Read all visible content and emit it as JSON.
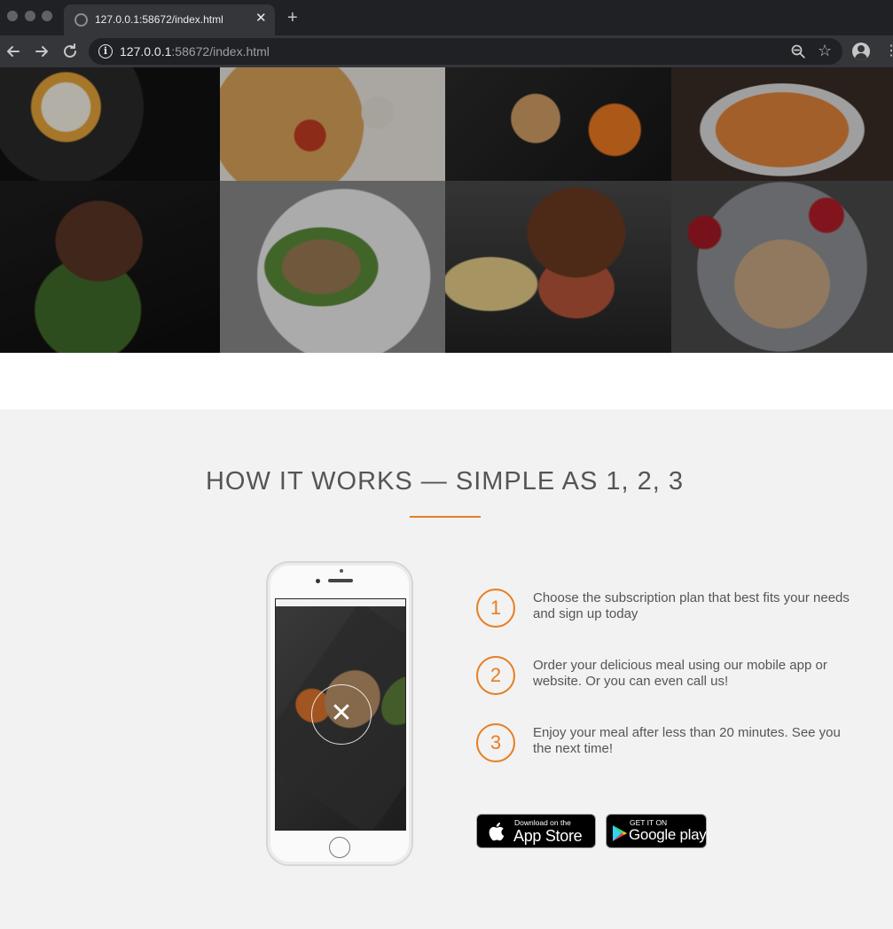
{
  "browser": {
    "tab_title": "127.0.0.1:58672/index.html",
    "tab_close": "✕",
    "new_tab": "+",
    "url_host": "127.0.0.1",
    "url_rest": ":58672/index.html",
    "colors": {
      "frame": "#202124",
      "toolbar": "#35363a"
    }
  },
  "gallery": {
    "tiles": [
      "egg-bibimbap",
      "pizza",
      "chicken-carrots",
      "pumpkin-soup",
      "steak-beans",
      "sandwich",
      "burger-fries",
      "granola-cherries"
    ]
  },
  "how_it_works": {
    "title": "HOW IT WORKS — SIMPLE AS 1, 2, 3",
    "accent_color": "#e67e22",
    "steps": [
      {
        "number": "1",
        "text": "Choose the subscription plan that best fits your needs and sign up today"
      },
      {
        "number": "2",
        "text": "Order your delicious meal using our mobile app or website. Or you can even call us!"
      },
      {
        "number": "3",
        "text": "Enjoy your meal after less than 20 minutes. See you the next time!"
      }
    ],
    "phone_logo_glyph": "✕",
    "app_store": {
      "small": "Download on the",
      "big": "App Store"
    },
    "google_play": {
      "small": "GET IT ON",
      "big": "Google play"
    }
  }
}
